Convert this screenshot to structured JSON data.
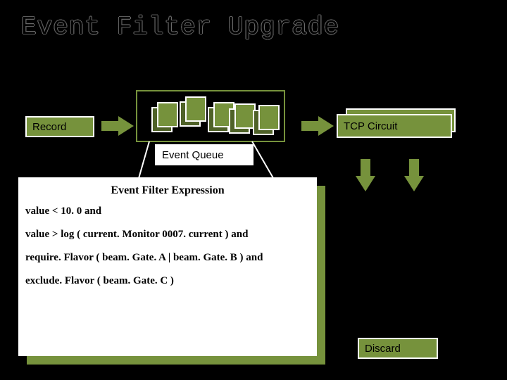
{
  "title": "Event Filter Upgrade",
  "record": "Record",
  "queue": "Event Queue",
  "tcp": "TCP Circuit",
  "discard": "Discard",
  "expr": {
    "heading": "Event Filter Expression",
    "l1": "value < 10. 0 and",
    "l2": "value > log ( current. Monitor 0007. current )  and",
    "l3": "require. Flavor ( beam. Gate. A | beam. Gate. B )  and",
    "l4": "exclude. Flavor ( beam. Gate. C )"
  }
}
